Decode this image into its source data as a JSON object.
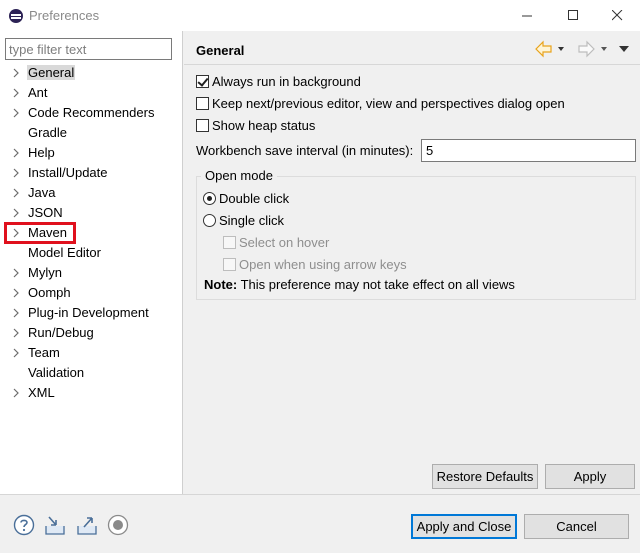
{
  "window": {
    "title": "Preferences",
    "controls": {
      "minimize": "—",
      "maximize": "☐",
      "close": "✕"
    }
  },
  "sidebar": {
    "filter_placeholder": "type filter text",
    "items": [
      {
        "label": "General",
        "expandable": true,
        "selected": true
      },
      {
        "label": "Ant",
        "expandable": true
      },
      {
        "label": "Code Recommenders",
        "expandable": true
      },
      {
        "label": "Gradle",
        "expandable": false
      },
      {
        "label": "Help",
        "expandable": true
      },
      {
        "label": "Install/Update",
        "expandable": true
      },
      {
        "label": "Java",
        "expandable": true
      },
      {
        "label": "JSON",
        "expandable": true
      },
      {
        "label": "Maven",
        "expandable": true,
        "highlighted": true
      },
      {
        "label": "Model Editor",
        "expandable": false
      },
      {
        "label": "Mylyn",
        "expandable": true
      },
      {
        "label": "Oomph",
        "expandable": true
      },
      {
        "label": "Plug-in Development",
        "expandable": true
      },
      {
        "label": "Run/Debug",
        "expandable": true
      },
      {
        "label": "Team",
        "expandable": true
      },
      {
        "label": "Validation",
        "expandable": false
      },
      {
        "label": "XML",
        "expandable": true
      }
    ]
  },
  "page": {
    "title": "General",
    "options": [
      {
        "label": "Always run in background",
        "checked": true
      },
      {
        "label": "Keep next/previous editor, view and perspectives dialog open",
        "checked": false
      },
      {
        "label": "Show heap status",
        "checked": false
      }
    ],
    "save_interval": {
      "label": "Workbench save interval (in minutes):",
      "value": "5"
    },
    "open_mode": {
      "legend": "Open mode",
      "double_click": "Double click",
      "single_click": "Single click",
      "selected": "double_click",
      "select_on_hover": "Select on hover",
      "open_arrow_keys": "Open when using arrow keys",
      "note_bold": "Note:",
      "note_text": " This preference may not take effect on all views"
    },
    "restore_defaults": "Restore Defaults",
    "apply": "Apply"
  },
  "footer": {
    "apply_and_close": "Apply and Close",
    "cancel": "Cancel",
    "icons": [
      "help-icon",
      "import-icon",
      "export-icon",
      "record-icon"
    ]
  },
  "colors": {
    "highlight_box": "#e0101d",
    "default_button_border": "#0078d7",
    "back_arrow": "#e8a31c"
  }
}
